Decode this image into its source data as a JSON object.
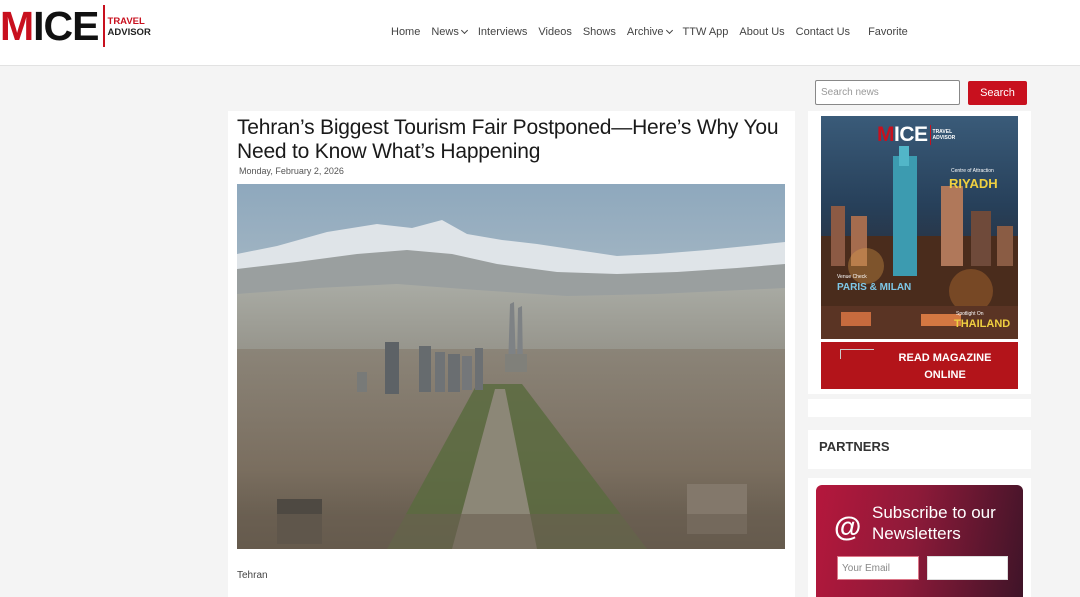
{
  "logo": {
    "mark_red": "M",
    "mark_dark": "ICE",
    "line1": "TRAVEL",
    "line2": "ADVISOR"
  },
  "nav": [
    {
      "label": "Home",
      "dropdown": false
    },
    {
      "label": "News",
      "dropdown": true
    },
    {
      "label": "Interviews",
      "dropdown": false
    },
    {
      "label": "Videos",
      "dropdown": false
    },
    {
      "label": "Shows",
      "dropdown": false
    },
    {
      "label": "Archive",
      "dropdown": true
    },
    {
      "label": "TTW App",
      "dropdown": false
    },
    {
      "label": "About Us",
      "dropdown": false
    },
    {
      "label": "Contact Us",
      "dropdown": false
    },
    {
      "label": "Favorite",
      "dropdown": false
    }
  ],
  "search": {
    "placeholder": "Search news",
    "button": "Search"
  },
  "article": {
    "title": "Tehran’s Biggest Tourism Fair Postponed—Here’s Why You Need to Know What’s Happening",
    "date": "Monday, February 2, 2026",
    "caption": "Tehran"
  },
  "magazine": {
    "logo_red": "M",
    "logo_white": "ICE",
    "logo_sub1": "TRAVEL",
    "logo_sub2": "ADVISOR",
    "tag1": "Centre of Attraction",
    "city1": "RIYADH",
    "tag2": "Venue Check",
    "city2": "PARIS & MILAN",
    "tag3": "Spotlight On",
    "city3": "THAILAND",
    "read_label": "READ MAGAZINE ONLINE"
  },
  "partners": {
    "title": "PARTNERS"
  },
  "newsletter": {
    "icon": "@",
    "title": "Subscribe to our Newsletters",
    "email_placeholder": "Your Email",
    "button": ""
  },
  "colors": {
    "brand_red": "#c8101e",
    "newsletter_start": "#b5173c",
    "newsletter_end": "#3e1428"
  }
}
